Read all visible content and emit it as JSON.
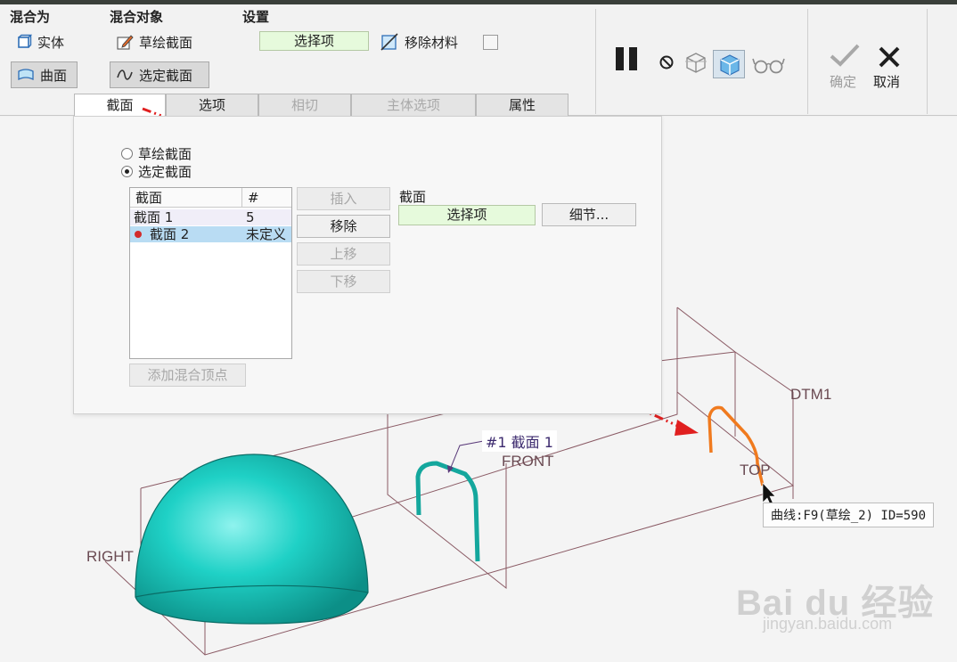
{
  "ribbon": {
    "groups": {
      "blend_as": "混合为",
      "blend_object": "混合对象",
      "settings": "设置"
    },
    "solid": "实体",
    "surface": "曲面",
    "sketch_section": "草绘截面",
    "selected_section": "选定截面",
    "select_item": "选择项",
    "remove_material": "移除材料",
    "confirm": "确定",
    "cancel": "取消"
  },
  "tabs": [
    "截面",
    "选项",
    "相切",
    "主体选项",
    "属性"
  ],
  "panel": {
    "radio_sketch": "草绘截面",
    "radio_selected": "选定截面",
    "table": {
      "headers": [
        "截面",
        "#"
      ],
      "rows": [
        {
          "name": "截面 1",
          "count": "5"
        },
        {
          "name": "截面 2",
          "count": "未定义"
        }
      ]
    },
    "buttons": {
      "insert": "插入",
      "remove": "移除",
      "move_up": "上移",
      "move_down": "下移"
    },
    "add_vertex": "添加混合顶点",
    "section_label": "截面",
    "section_select": "选择项",
    "details": "细节..."
  },
  "viewport": {
    "labels": {
      "dtm1": "DTM1",
      "front": "FRONT",
      "top": "TOP",
      "right": "RIGHT",
      "section_tag": "#1 截面 1"
    },
    "tooltip": "曲线:F9(草绘_2) ID=590",
    "watermark": {
      "logo": "Bai du 经验",
      "url": "jingyan.baidu.com"
    }
  },
  "colors": {
    "accent_green": "#e6fadc",
    "surface_teal": "#19c8bd",
    "section1_teal": "#14a79d",
    "section2_orange": "#f07a1e",
    "arrow_red": "#e01f1f",
    "datum_line": "#8a5a64"
  },
  "icons": [
    "solid-cube-icon",
    "surface-icon",
    "pencil-sketch-icon",
    "curve-select-icon",
    "remove-material-icon",
    "pause-icon",
    "stop-icon",
    "preview-wire-icon",
    "preview-solid-icon",
    "glasses-icon",
    "check-icon",
    "x-icon"
  ]
}
